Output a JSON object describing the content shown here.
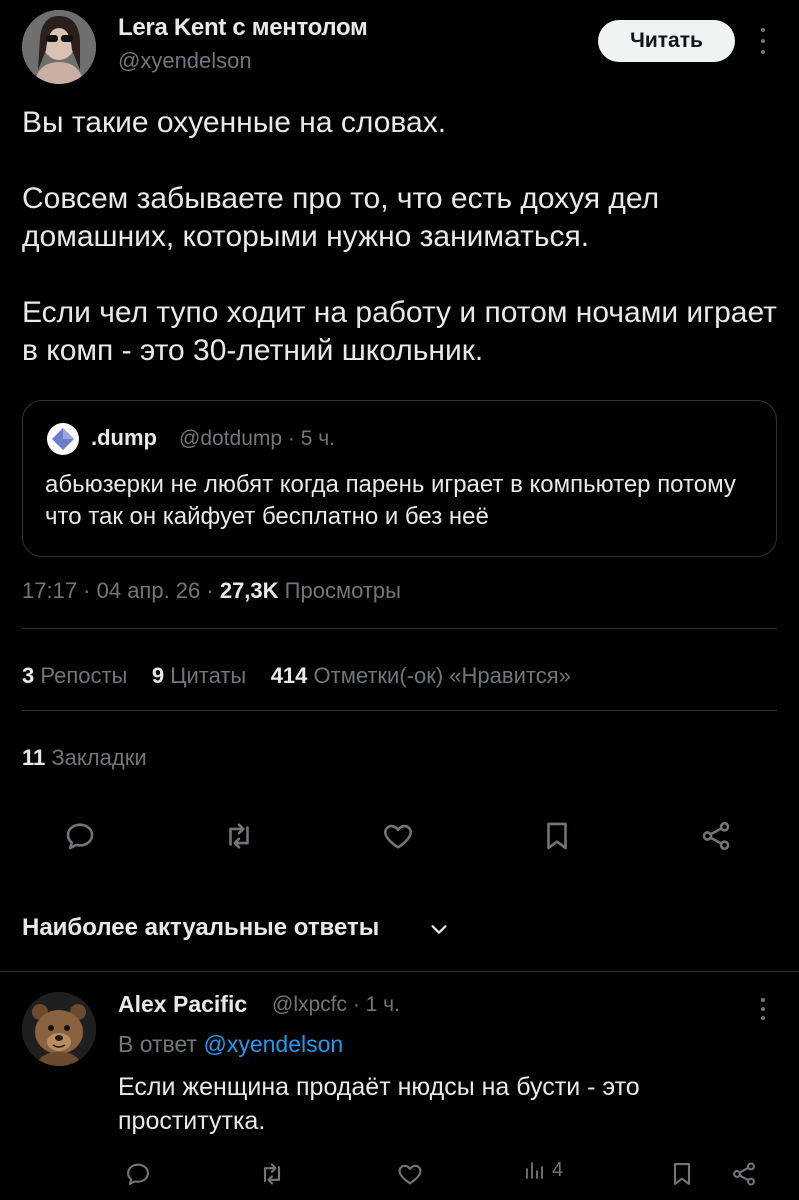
{
  "author": {
    "name": "Lera Kent с ментолом",
    "handle": "@xyendelson",
    "follow_label": "Читать"
  },
  "tweet": {
    "paragraphs": [
      "Вы такие охуенные на словах.",
      "Совсем забываете про то, что есть дохуя дел домашних, которыми нужно заниматься.",
      "Если чел тупо ходит на работу и потом ночами играет в комп - это 30-летний школьник."
    ],
    "quote": {
      "name": ".dump",
      "handle_time": "@dotdump · 5 ч.",
      "text": "абьюзерки не любят когда парень играет в компьютер потому что так он кайфует бесплатно и без неё"
    },
    "time_date": "17:17 · 04 апр. 26 · ",
    "views_count": "27,3K",
    "views_label": " Просмотры"
  },
  "stats": {
    "reposts_count": "3",
    "reposts_label": "Репосты",
    "quotes_count": "9",
    "quotes_label": "Цитаты",
    "likes_count": "414",
    "likes_label": "Отметки(-ок) «Нравится»",
    "bookmarks_count": "11",
    "bookmarks_label": "Закладки"
  },
  "replies_sort": {
    "label": "Наиболее актуальные ответы"
  },
  "reply": {
    "name": "Alex Pacific",
    "handle_time": "@lxpcfc · 1 ч.",
    "reply_to_prefix": "В ответ ",
    "reply_to_handle": "@xyendelson",
    "text": "Если женщина продаёт нюдсы на бусти - это проститутка.",
    "views_count": "4"
  },
  "colors": {
    "background": "#000000",
    "text_primary": "#e7e9ea",
    "text_secondary": "#71767b",
    "link": "#1d9bf0",
    "divider": "#2f3336"
  }
}
